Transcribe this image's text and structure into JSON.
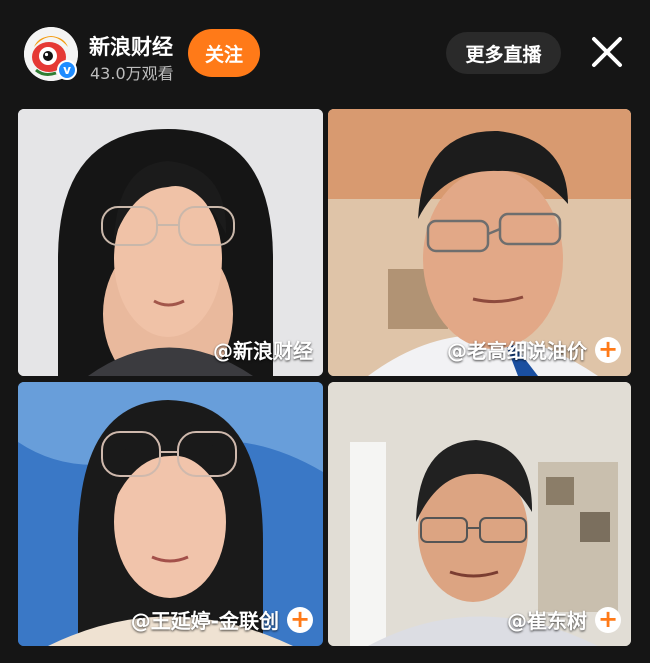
{
  "header": {
    "host_name": "新浪财经",
    "viewers": "43.0万观看",
    "follow_label": "关注",
    "more_live_label": "更多直播"
  },
  "tiles": [
    {
      "label": "@新浪财经",
      "follow_plus": false
    },
    {
      "label": "@老高细说油价",
      "follow_plus": true
    },
    {
      "label": "@王延婷-金联创",
      "follow_plus": true
    },
    {
      "label": "@崔东树",
      "follow_plus": true
    }
  ],
  "plus_symbol": "+",
  "colors": {
    "accent": "#ff7a18",
    "background": "#151515",
    "verified": "#1f8cff"
  },
  "icons": {
    "close": "close-icon",
    "verified": "verified-badge-icon",
    "avatar": "weibo-eye-logo-icon"
  }
}
